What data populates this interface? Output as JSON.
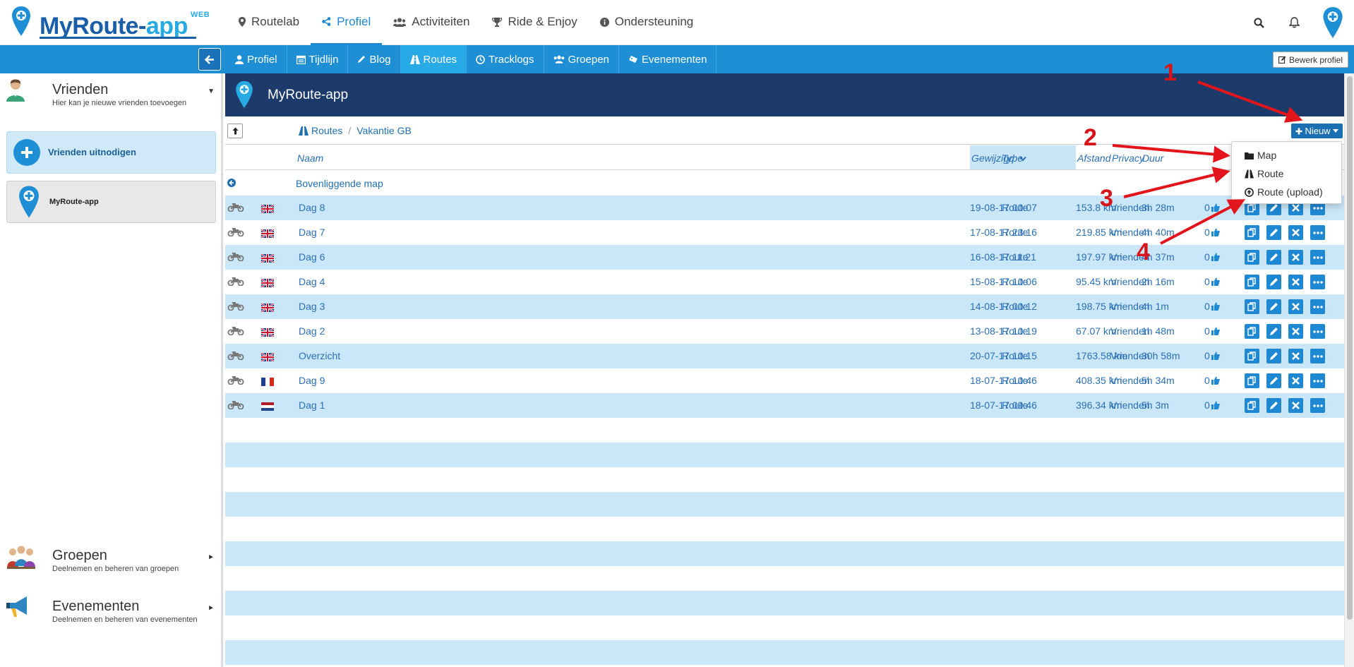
{
  "brand": {
    "name_part1": "MyRoute-",
    "name_part2": "app",
    "badge": "WEB"
  },
  "top_nav": [
    {
      "label": "Routelab",
      "icon": "map-marker-icon",
      "active": false
    },
    {
      "label": "Profiel",
      "icon": "share-icon",
      "active": true
    },
    {
      "label": "Activiteiten",
      "icon": "users-icon",
      "active": false
    },
    {
      "label": "Ride & Enjoy",
      "icon": "trophy-icon",
      "active": false
    },
    {
      "label": "Ondersteuning",
      "icon": "info-circle-icon",
      "active": false
    }
  ],
  "tabs": [
    {
      "label": "Profiel",
      "icon": "user-icon",
      "active": false
    },
    {
      "label": "Tijdlijn",
      "icon": "calendar-icon",
      "active": false
    },
    {
      "label": "Blog",
      "icon": "pencil-icon",
      "active": false
    },
    {
      "label": "Routes",
      "icon": "road-icon",
      "active": true
    },
    {
      "label": "Tracklogs",
      "icon": "clock-icon",
      "active": false
    },
    {
      "label": "Groepen",
      "icon": "users-icon",
      "active": false
    },
    {
      "label": "Evenementen",
      "icon": "ticket-icon",
      "active": false
    }
  ],
  "edit_profile_label": "Bewerk profiel",
  "sidebar": {
    "friends": {
      "title": "Vrienden",
      "subtitle": "Hier kan je nieuwe vrienden toevoegen"
    },
    "invite_label": "Vrienden uitnodigen",
    "friend_item": "MyRoute-app",
    "groups": {
      "title": "Groepen",
      "subtitle": "Deelnemen en beheren van groepen"
    },
    "events": {
      "title": "Evenementen",
      "subtitle": "Deelnemen en beheren van evenementen"
    }
  },
  "main": {
    "header_title": "MyRoute-app",
    "breadcrumb": [
      "Routes",
      "Vakantie GB"
    ],
    "new_button": "Nieuw",
    "parent_folder": "Bovenliggende map"
  },
  "table": {
    "columns": {
      "name": "Naam",
      "type": "Type",
      "privacy": "Privacy",
      "modified": "Gewijzigd",
      "distance": "Afstand",
      "duration": "Duur"
    },
    "rows": [
      {
        "flag": "gb",
        "name": "Dag 8",
        "type": "Route",
        "privacy": "Vrienden",
        "modified": "19-08-17 00:07",
        "distance": "153.8 km",
        "duration": "3h 28m",
        "likes": "0"
      },
      {
        "flag": "gb",
        "name": "Dag 7",
        "type": "Route",
        "privacy": "Vrienden",
        "modified": "17-08-17 23:16",
        "distance": "219.85 km",
        "duration": "4h 40m",
        "likes": "0"
      },
      {
        "flag": "gb",
        "name": "Dag 6",
        "type": "Route",
        "privacy": "Vrienden",
        "modified": "16-08-17 11:21",
        "distance": "197.97 km",
        "duration": "4h 37m",
        "likes": "0"
      },
      {
        "flag": "gb",
        "name": "Dag 4",
        "type": "Route",
        "privacy": "Vrienden",
        "modified": "15-08-17 10:06",
        "distance": "95.45 km",
        "duration": "2h 16m",
        "likes": "0"
      },
      {
        "flag": "gb",
        "name": "Dag 3",
        "type": "Route",
        "privacy": "Vrienden",
        "modified": "14-08-17 00:12",
        "distance": "198.75 km",
        "duration": "4h 1m",
        "likes": "0"
      },
      {
        "flag": "gb",
        "name": "Dag 2",
        "type": "Route",
        "privacy": "Vrienden",
        "modified": "13-08-17 10:19",
        "distance": "67.07 km",
        "duration": "1h 48m",
        "likes": "0"
      },
      {
        "flag": "gb",
        "name": "Overzicht",
        "type": "Route",
        "privacy": "Vrienden",
        "modified": "20-07-17 10:15",
        "distance": "1763.58 km",
        "duration": "30h 58m",
        "likes": "0"
      },
      {
        "flag": "fr",
        "name": "Dag 9",
        "type": "Route",
        "privacy": "Vrienden",
        "modified": "18-07-17 10:46",
        "distance": "408.35 km",
        "duration": "5h 34m",
        "likes": "0"
      },
      {
        "flag": "nl",
        "name": "Dag 1",
        "type": "Route",
        "privacy": "Vrienden",
        "modified": "18-07-17 09:46",
        "distance": "396.34 km",
        "duration": "5h 3m",
        "likes": "0"
      }
    ]
  },
  "dropdown": [
    {
      "label": "Map",
      "icon": "folder-icon"
    },
    {
      "label": "Route",
      "icon": "road-icon"
    },
    {
      "label": "Route (upload)",
      "icon": "upload-icon"
    }
  ],
  "annotations": [
    "1",
    "2",
    "3",
    "4"
  ],
  "colors": {
    "primary_blue": "#1e8fd5",
    "header_navy": "#1c3b6b",
    "row_stripe": "#cae7f9",
    "arrow_red": "#e3151c"
  }
}
